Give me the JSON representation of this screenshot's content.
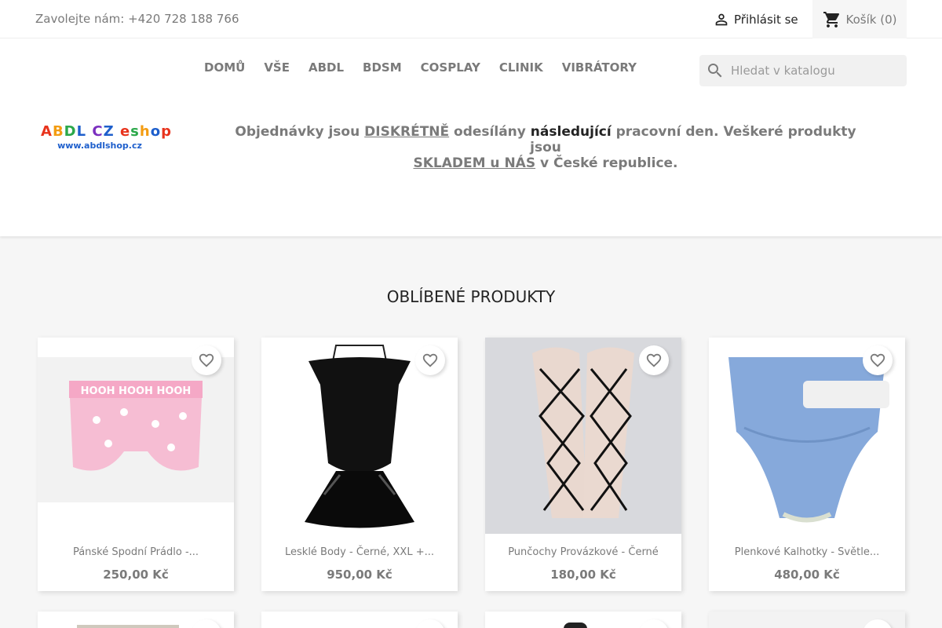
{
  "topbar": {
    "contact": "Zavolejte nám: +420 728 188 766",
    "signin": "Přihlásit se",
    "cart": "Košík (0)"
  },
  "nav": [
    "DOMŮ",
    "VŠE",
    "ABDL",
    "BDSM",
    "COSPLAY",
    "CLINIK",
    "VIBRÁTORY"
  ],
  "search": {
    "placeholder": "Hledat v katalogu"
  },
  "logo": {
    "text": "ABDL CZ eshop",
    "url_text": "www.abdlshop.cz"
  },
  "banner": {
    "part1": "Objednávky jsou ",
    "link1": "DISKRÉTNĚ",
    "part2": " odesílány ",
    "dark1": "následující",
    "part3": " pracovní den. Veškeré produkty jsou",
    "link2": "SKLADEM u NÁS",
    "part4": " v České republice."
  },
  "section_title": "OBLÍBENÉ PRODUKTY",
  "products": [
    {
      "title": "Pánské Spodní Prádlo -...",
      "price": "250,00 Kč"
    },
    {
      "title": "Lesklé Body - Černé, XXL +...",
      "price": "950,00 Kč"
    },
    {
      "title": "Punčochy Provázkové - Černé",
      "price": "180,00 Kč"
    },
    {
      "title": "Plenkové Kalhotky - Světle...",
      "price": "480,00 Kč"
    }
  ],
  "icons": {
    "user": "user-icon",
    "cart": "cart-icon",
    "search": "search-icon",
    "favorite": "heart-icon"
  }
}
